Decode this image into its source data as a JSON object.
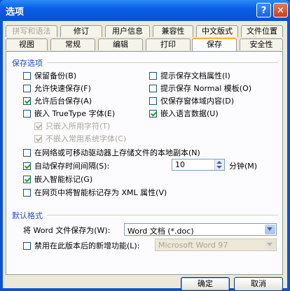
{
  "window": {
    "title": "选项",
    "help_glyph": "?",
    "close_glyph": "✕"
  },
  "tabs_row1": [
    {
      "label": "拼写和语法",
      "disabled": true
    },
    {
      "label": "修订"
    },
    {
      "label": "用户信息"
    },
    {
      "label": "兼容性"
    },
    {
      "label": "中文版式"
    },
    {
      "label": "文件位置"
    }
  ],
  "tabs_row2": [
    {
      "label": "视图"
    },
    {
      "label": "常规"
    },
    {
      "label": "编辑"
    },
    {
      "label": "打印"
    },
    {
      "label": "保存",
      "active": true
    },
    {
      "label": "安全性"
    }
  ],
  "save_options": {
    "heading": "保存选项",
    "left": [
      {
        "label": "保留备份(B)",
        "checked": false
      },
      {
        "label": "允许快速保存(F)",
        "checked": false
      },
      {
        "label": "允许后台保存(A)",
        "checked": true
      },
      {
        "label": "嵌入 TrueType 字体(E)",
        "checked": false
      },
      {
        "label": "只嵌入所用字符(T)",
        "checked": true,
        "disabled": true
      },
      {
        "label": "不嵌入常用系统字体(C)",
        "checked": true,
        "disabled": true
      }
    ],
    "right": [
      {
        "label": "提示保存文档属性(I)",
        "checked": false
      },
      {
        "label": "提示保存 Normal 模板(O)",
        "checked": false
      },
      {
        "label": "仅保存窗体域内容(D)",
        "checked": false
      },
      {
        "label": "嵌入语言数据(U)",
        "checked": true
      }
    ],
    "full": [
      {
        "label": "在网络或可移动驱动器上存储文件的本地副本(N)",
        "checked": false
      },
      {
        "label": "自动保存时间间隔(S):",
        "checked": true
      },
      {
        "label": "嵌入智能标记(G)",
        "checked": true
      },
      {
        "label": "在网页中将智能标记存为 XML 属性(V)",
        "checked": false
      }
    ],
    "autosave_minutes": "10",
    "minutes_label": "分钟(M)"
  },
  "default_format": {
    "heading": "默认格式",
    "save_as_label": "将 Word 文件保存为(W):",
    "save_as_value": "Word 文档 (*.doc)",
    "disable_features_label": "禁用在此版本后的新增功能(L):",
    "disable_features_checked": false,
    "disable_features_value": "Microsoft Word 97"
  },
  "buttons": {
    "ok": "确定",
    "cancel": "取消"
  }
}
